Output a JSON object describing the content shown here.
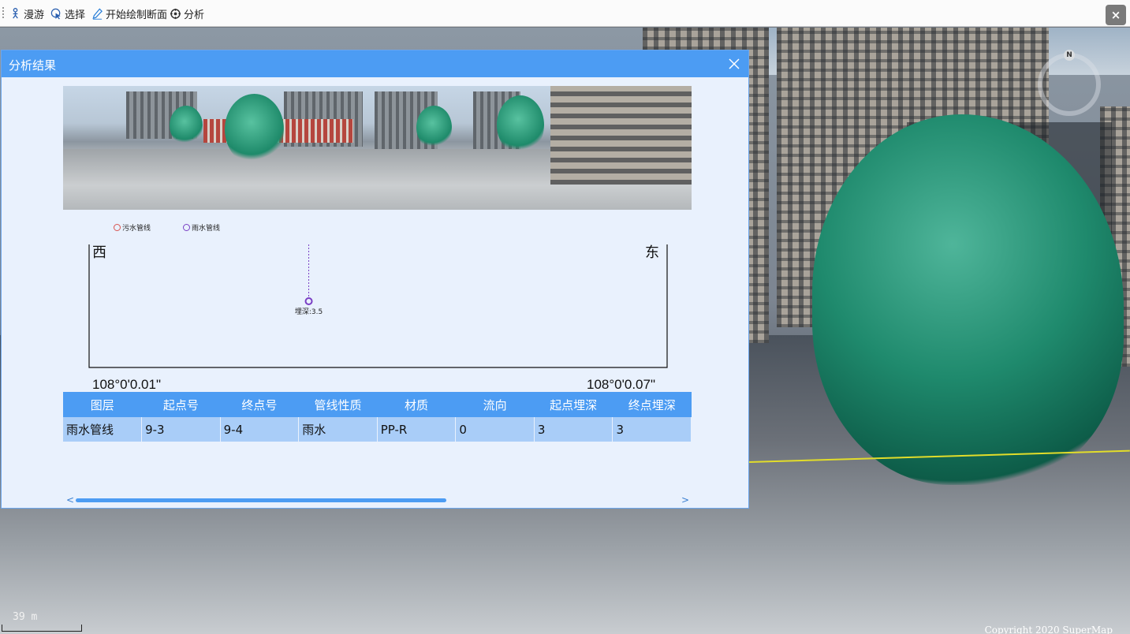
{
  "toolbar": {
    "items": [
      {
        "label": "漫游",
        "icon": "roam-person-icon"
      },
      {
        "label": "选择",
        "icon": "select-cursor-icon"
      },
      {
        "label": "开始绘制断面",
        "icon": "draw-pencil-icon"
      },
      {
        "label": "分析",
        "icon": "analyze-icon"
      }
    ],
    "close": "×"
  },
  "dialog": {
    "title": "分析结果",
    "legend": [
      {
        "label": "污水管线",
        "color": "#d9534f"
      },
      {
        "label": "雨水管线",
        "color": "#7a3fc4"
      }
    ]
  },
  "chart_data": {
    "type": "scatter",
    "direction_left": "西",
    "direction_right": "东",
    "x_start_label": "108°0'0.01\"",
    "x_end_label": "108°0'0.07\"",
    "points": [
      {
        "series": "雨水管线",
        "x_fraction": 0.38,
        "label": "埋深:3.5",
        "color": "#7a3fc4"
      }
    ]
  },
  "table": {
    "columns": [
      "图层",
      "起点号",
      "终点号",
      "管线性质",
      "材质",
      "流向",
      "起点埋深",
      "终点埋深"
    ],
    "rows": [
      [
        "雨水管线",
        "9-3",
        "9-4",
        "雨水",
        "PP-R",
        "0",
        "3",
        "3"
      ]
    ]
  },
  "scrollbar": {
    "left": "<",
    "right": ">"
  },
  "scene": {
    "scale": "39 m",
    "copyright": "Copyright 2020 SuperMap",
    "compass": "N",
    "profile_line_color": "#e2dd2a"
  }
}
